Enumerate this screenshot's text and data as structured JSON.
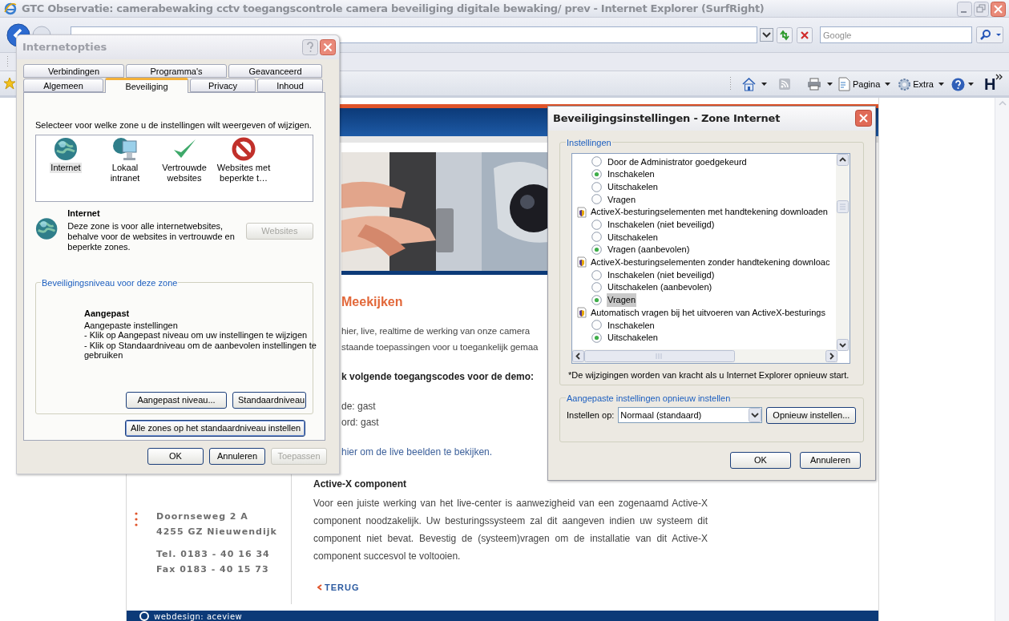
{
  "browser": {
    "title": "GTC Observatie: camerabewaking cctv toegangscontrole camera beveiliging digitale bewaking/ prev - Internet Explorer (SurfRight)",
    "search_placeholder": "Google",
    "page_menu": "Pagina",
    "tools_menu": "Extra",
    "addon_label": "H"
  },
  "webpage": {
    "heading": "Meekijken",
    "intro_lines": [
      "hier, live, realtime de werking van onze camera",
      "staande toepassingen voor u toegankelijk gemaa"
    ],
    "codes_heading": "k volgende toegangscodes voor de demo:",
    "codes": [
      "de: gast",
      "ord: gast"
    ],
    "live_link": "hier om de live beelden te bekijken.",
    "activex_title": "Active-X component",
    "activex_text": "Voor een juiste werking van het live-center is aanwezigheid van een zogenaamd Active-X component noodzakelijk. Uw besturingssysteem zal dit aangeven indien uw systeem dit component niet bevat. Bevestig de (systeem)vragen om de installatie van dit Active-X component succesvol te voltooien.",
    "back_link": "TERUG",
    "address": [
      "Doornseweg 2 A",
      "4255 GZ Nieuwendijk"
    ],
    "phone": [
      "Tel. 0183 - 40 16 34",
      "Fax 0183 - 40 15 73"
    ],
    "footer": "webdesign: aceview"
  },
  "options_dialog": {
    "title": "Internetopties",
    "tabs_row1": [
      {
        "label": "Verbindingen",
        "selected": false
      },
      {
        "label": "Programma's",
        "selected": false
      },
      {
        "label": "Geavanceerd",
        "selected": false
      }
    ],
    "tabs_row2": [
      {
        "label": "Algemeen",
        "selected": false
      },
      {
        "label": "Beveiliging",
        "selected": true
      },
      {
        "label": "Privacy",
        "selected": false
      },
      {
        "label": "Inhoud",
        "selected": false
      }
    ],
    "zone_prompt": "Selecteer voor welke zone u de instellingen wilt weergeven of wijzigen.",
    "zones": [
      {
        "kind": "internet",
        "label": "Internet",
        "selected": true
      },
      {
        "kind": "intranet",
        "label": "Lokaal intranet",
        "selected": false
      },
      {
        "kind": "trusted",
        "label": "Vertrouwde websites",
        "selected": false
      },
      {
        "kind": "restricted",
        "label": "Websites met beperkte t…",
        "selected": false
      }
    ],
    "zone_name": "Internet",
    "zone_description": "Deze zone is voor alle internetwebsites, behalve voor de websites in vertrouwde en beperkte zones.",
    "websites_button": {
      "label": "Websites",
      "disabled": true
    },
    "level_group": "Beveiligingsniveau voor deze zone",
    "level_name": "Aangepast",
    "level_lines": [
      "Aangepaste instellingen",
      "- Klik op Aangepast niveau om uw instellingen te wijzigen",
      "- Klik op Standaardniveau om de aanbevolen instellingen te gebruiken"
    ],
    "custom_level_button": "Aangepast niveau...",
    "default_level_button": "Standaardniveau",
    "reset_all_button": "Alle zones op het standaardniveau instellen",
    "buttons": [
      {
        "label": "OK",
        "disabled": false
      },
      {
        "label": "Annuleren",
        "disabled": false
      },
      {
        "label": "Toepassen",
        "disabled": true
      }
    ]
  },
  "security_dialog": {
    "title": "Beveiligingsinstellingen - Zone Internet",
    "group": "Instellingen",
    "settings": [
      {
        "kind": "option",
        "label": "Door de Administrator goedgekeurd",
        "selected": false,
        "focused": false
      },
      {
        "kind": "option",
        "label": "Inschakelen",
        "selected": true,
        "focused": false
      },
      {
        "kind": "option",
        "label": "Uitschakelen",
        "selected": false,
        "focused": false
      },
      {
        "kind": "option",
        "label": "Vragen",
        "selected": false,
        "focused": false
      },
      {
        "kind": "header",
        "label": "ActiveX-besturingselementen met handtekening downloaden"
      },
      {
        "kind": "option",
        "label": "Inschakelen (niet beveiligd)",
        "selected": false,
        "focused": false
      },
      {
        "kind": "option",
        "label": "Uitschakelen",
        "selected": false,
        "focused": false
      },
      {
        "kind": "option",
        "label": "Vragen (aanbevolen)",
        "selected": true,
        "focused": false
      },
      {
        "kind": "header",
        "label": "ActiveX-besturingselementen zonder handtekening downloac"
      },
      {
        "kind": "option",
        "label": "Inschakelen (niet beveiligd)",
        "selected": false,
        "focused": false
      },
      {
        "kind": "option",
        "label": "Uitschakelen (aanbevolen)",
        "selected": false,
        "focused": false
      },
      {
        "kind": "option",
        "label": "Vragen",
        "selected": true,
        "focused": true
      },
      {
        "kind": "header",
        "label": "Automatisch vragen bij het uitvoeren van ActiveX-besturings"
      },
      {
        "kind": "option",
        "label": "Inschakelen",
        "selected": false,
        "focused": false
      },
      {
        "kind": "option",
        "label": "Uitschakelen",
        "selected": true,
        "focused": false
      }
    ],
    "note": "*De wijzigingen worden van kracht als u Internet Explorer opnieuw start.",
    "reset_group": "Aangepaste instellingen opnieuw instellen",
    "reset_label": "Instellen op:",
    "reset_value": "Normaal (standaard)",
    "reset_button": "Opnieuw instellen...",
    "buttons": [
      "OK",
      "Annuleren"
    ]
  }
}
